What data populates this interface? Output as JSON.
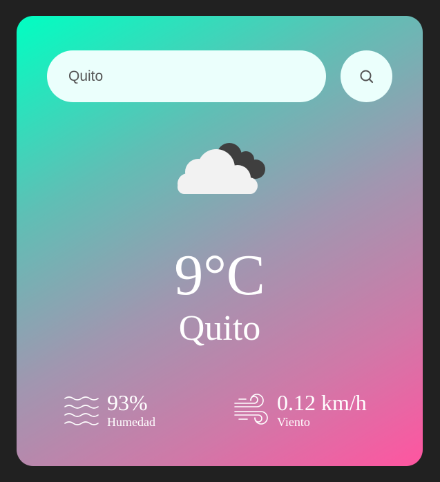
{
  "search": {
    "value": "Quito",
    "button_icon": "search-icon"
  },
  "weather": {
    "icon": "cloudy-icon",
    "temperature": "9°C",
    "city": "Quito"
  },
  "details": {
    "humidity": {
      "icon": "humidity-waves-icon",
      "value": "93%",
      "label": "Humedad"
    },
    "wind": {
      "icon": "wind-icon",
      "value": "0.12 km/h",
      "label": "Viento"
    }
  },
  "colors": {
    "page_background": "#212121",
    "gradient_start": "#00ffc2",
    "gradient_end": "#ff55a0",
    "search_background": "#ebfffc",
    "text": "#ffffff"
  }
}
